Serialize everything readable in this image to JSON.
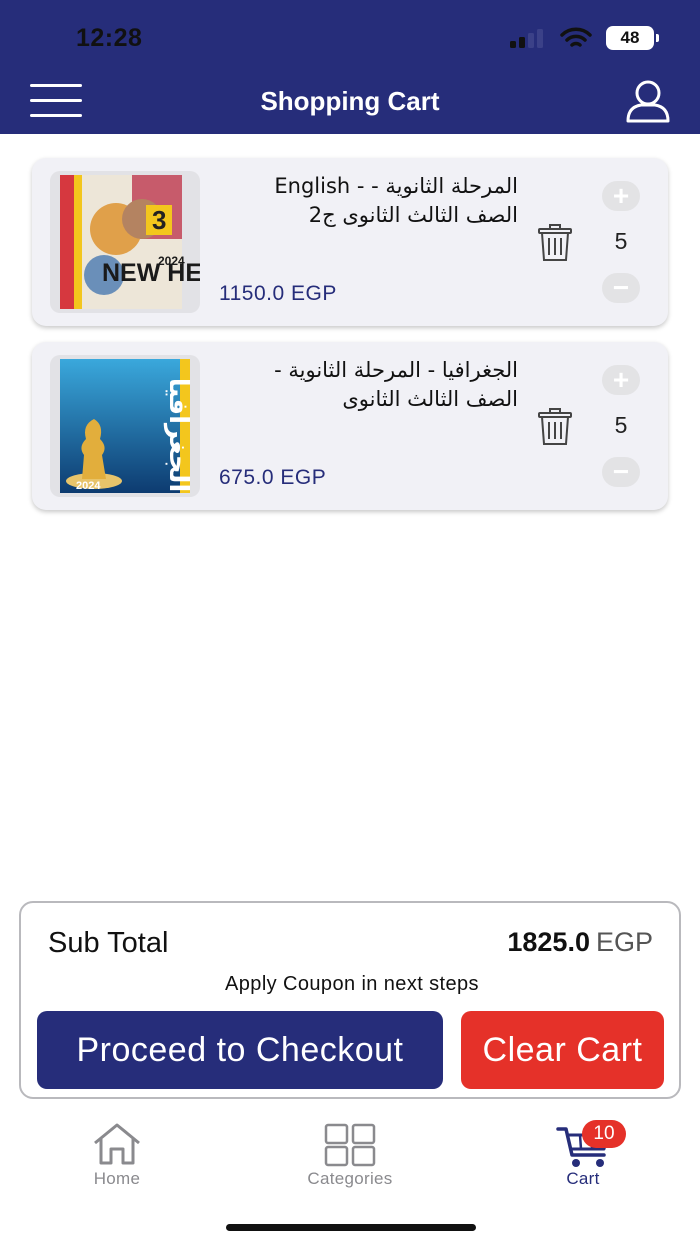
{
  "status_bar": {
    "time": "12:28",
    "battery": "48"
  },
  "header": {
    "title": "Shopping Cart",
    "menu_icon": "hamburger-menu-icon",
    "user_icon": "user-profile-icon"
  },
  "cart_items": [
    {
      "name_line1": "المرحلة الثانوية - - English",
      "name_line2": "الصف الثالث الثانوى ج2",
      "price": "1150.0 EGP",
      "quantity": "5",
      "cover_text": "NEW HELLO!",
      "cover_year": "2024"
    },
    {
      "name_line1": "الجغرافيا - المرحلة الثانوية -",
      "name_line2": "الصف الثالث الثانوى",
      "price": "675.0 EGP",
      "quantity": "5",
      "cover_text": "الجغرافيا",
      "cover_year": "2024"
    }
  ],
  "summary": {
    "sub_total_label": "Sub Total",
    "sub_total_value": "1825.0",
    "currency": "EGP",
    "coupon_note": "Apply Coupon in next steps",
    "checkout_label": "Proceed to Checkout",
    "clear_label": "Clear Cart"
  },
  "bottom_nav": {
    "home": "Home",
    "categories": "Categories",
    "cart": "Cart",
    "cart_badge": "10"
  },
  "colors": {
    "primary": "#262d7a",
    "danger": "#e53129",
    "card_bg": "#f1f1f6"
  }
}
